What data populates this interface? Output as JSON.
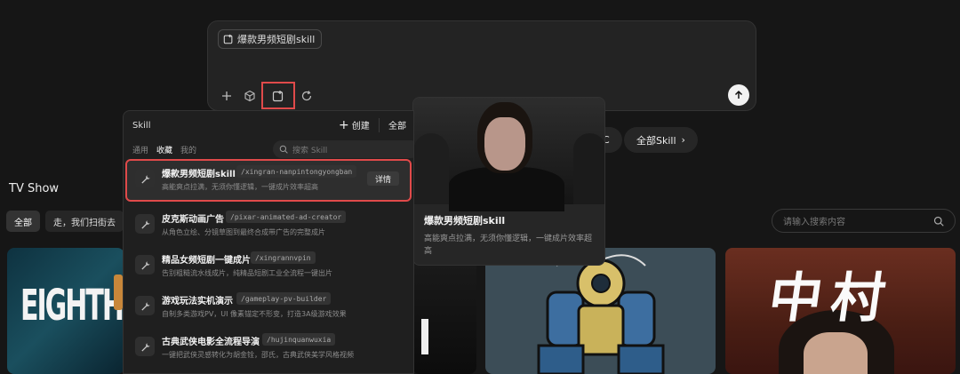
{
  "composer": {
    "chip_label": "爆款男频短剧skill",
    "tools": [
      "plus-icon",
      "cube-icon",
      "skill-icon",
      "refresh-icon"
    ],
    "send_icon": "arrow-up-icon"
  },
  "page": {
    "section_title": "TV Show",
    "tags": [
      "全部",
      "走，我们扫街去"
    ],
    "pill_c": "C",
    "pill_all": "全部Skill",
    "search_placeholder": "请输入搜索内容",
    "card1_text": "EIGHTH",
    "card4_text": "中村"
  },
  "menu": {
    "title": "Skill",
    "create_label": "创建",
    "all_label": "全部",
    "tabs": [
      "通用",
      "收藏",
      "我的"
    ],
    "active_tab": "收藏",
    "search_placeholder": "搜索 Skill",
    "detail_label": "详情",
    "items": [
      {
        "name": "爆款男频短剧skill",
        "slug": "/xingran-nanpintongyongban",
        "desc": "高能爽点拉满，无须你懂逻辑，一键成片效率超高"
      },
      {
        "name": "皮克斯动画广告",
        "slug": "/pixar-animated-ad-creator",
        "desc": "从角色立绘、分镜草图到最终合成带广告的完整成片"
      },
      {
        "name": "精品女频短剧一键成片",
        "slug": "/xingrannvpin",
        "desc": "告别粗糙流水线成片，纯精品短剧工业全流程一键出片"
      },
      {
        "name": "游戏玩法实机演示",
        "slug": "/gameplay-pv-builder",
        "desc": "自制多类游戏PV，UI 像素锚定不形变，打造3A级游戏效果"
      },
      {
        "name": "古典武侠电影全流程导演",
        "slug": "/hujinquanwuxia",
        "desc": "一键把武侠灵感转化为胡金铨，邵氏，古典武侠美学风格视频"
      }
    ]
  },
  "preview": {
    "title": "爆款男频短剧skill",
    "desc": "高能爽点拉满，无须你懂逻辑，一键成片效率超高"
  },
  "colors": {
    "highlight": "#e04a4a",
    "background": "#161616",
    "panel": "#1f1f1f"
  }
}
